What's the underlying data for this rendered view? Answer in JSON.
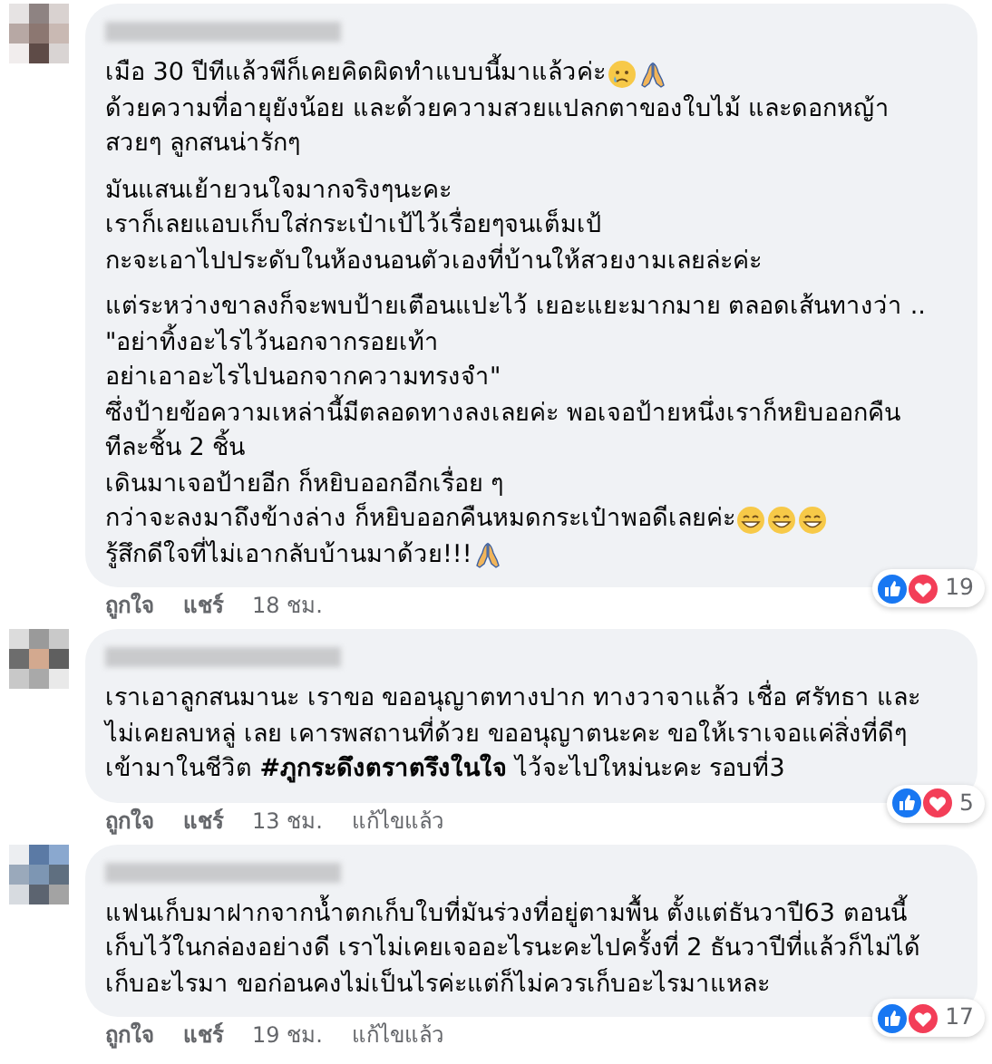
{
  "comments": [
    {
      "paragraphs": [
        [
          {
            "text": "เมือ 30 ปีทีแล้วพีก็เคยคิดผิดทำแบบนี้มาแล้วค่ะ",
            "icons": [
              {
                "kind": "sad-face"
              },
              {
                "kind": "folded-hands"
              }
            ]
          },
          {
            "text": "ด้วยความที่อายุยังน้อย และด้วยความสวยแปลกตาของใบไม้ และดอกหญ้า"
          },
          {
            "text": "สวยๆ ลูกสนน่ารักๆ"
          }
        ],
        [
          {
            "text": "มันแสนเย้ายวนใจมากจริงๆนะคะ"
          },
          {
            "text": "เราก็เลยแอบเก็บใส่กระเป๋าเป้ไว้เรื่อยๆจนเต็มเป้"
          },
          {
            "text": "กะจะเอาไปประดับในห้องนอนตัวเองที่บ้านให้สวยงามเลยล่ะค่ะ"
          }
        ],
        [
          {
            "text": "แต่ระหว่างขาลงก็จะพบป้ายเตือนแปะไว้ เยอะแยะมากมาย ตลอดเส้นทางว่า .."
          },
          {
            "text": "\"อย่าทิ้งอะไรไว้นอกจากรอยเท้า"
          },
          {
            "text": "อย่าเอาอะไรไปนอกจากความทรงจำ\""
          },
          {
            "text": "ซึ่งป้ายข้อความเหล่านี้มีตลอดทางลงเลยค่ะ พอเจอป้ายหนึ่งเราก็หยิบออกคืน"
          },
          {
            "text": "ทีละชิ้น 2 ชิ้น"
          },
          {
            "text": "เดินมาเจอป้ายอีก ก็หยิบออกอีกเรื่อย ๆ"
          },
          {
            "text": "กว่าจะลงมาถึงข้างล่าง ก็หยิบออกคืนหมดกระเป๋าพอดีเลยค่ะ",
            "icons": [
              {
                "kind": "grinning-face"
              },
              {
                "kind": "grinning-face"
              },
              {
                "kind": "grinning-face"
              }
            ]
          },
          {
            "text": "รู้สึกดีใจที่ไม่เอากลับบ้านมาด้วย!!!",
            "icons": [
              {
                "kind": "folded-hands"
              }
            ]
          }
        ]
      ],
      "reaction_count": "19",
      "actions": [
        "ถูกใจ",
        "แชร์"
      ],
      "time": "18 ชม."
    },
    {
      "paragraphs": [
        [
          {
            "text": "เราเอาลูกสนมานะ เราขอ ขออนุญาตทางปาก ทางวาจาแล้ว เชื่อ ศรัทธา และ"
          },
          {
            "text": "ไม่เคยลบหลู่ เลย เคารพสถานที่ด้วย ขออนุญาตนะคะ ขอให้เราเจอแค่สิ่งที่ดีๆ"
          },
          {
            "text": "เข้ามาในชีวิต **#ภูกระดึงตราตรึงในใจ** ไว้จะไปใหม่นะคะ รอบที่3"
          }
        ]
      ],
      "reaction_count": "5",
      "actions": [
        "ถูกใจ",
        "แชร์"
      ],
      "time": "13 ชม.",
      "edited": "แก้ไขแล้ว"
    },
    {
      "paragraphs": [
        [
          {
            "text": "แฟนเก็บมาฝากจากน้ำตกเก็บใบที่มันร่วงที่อยู่ตามพื้น ตั้งแต่ธันวาปี63 ตอนนี้"
          },
          {
            "text": "เก็บไว้ในกล่องอย่างดี เราไม่เคยเจออะไรนะคะไปครั้งที่ 2 ธันวาปีที่แล้วก็ไม่ได้"
          },
          {
            "text": "เก็บอะไรมา ขอก่อนคงไม่เป็นไรค่ะแต่ก็ไม่ควรเก็บอะไรมาแหละ"
          }
        ]
      ],
      "reaction_count": "17",
      "actions": [
        "ถูกใจ",
        "แชร์"
      ],
      "time": "19 ชม.",
      "edited": "แก้ไขแล้ว"
    }
  ]
}
